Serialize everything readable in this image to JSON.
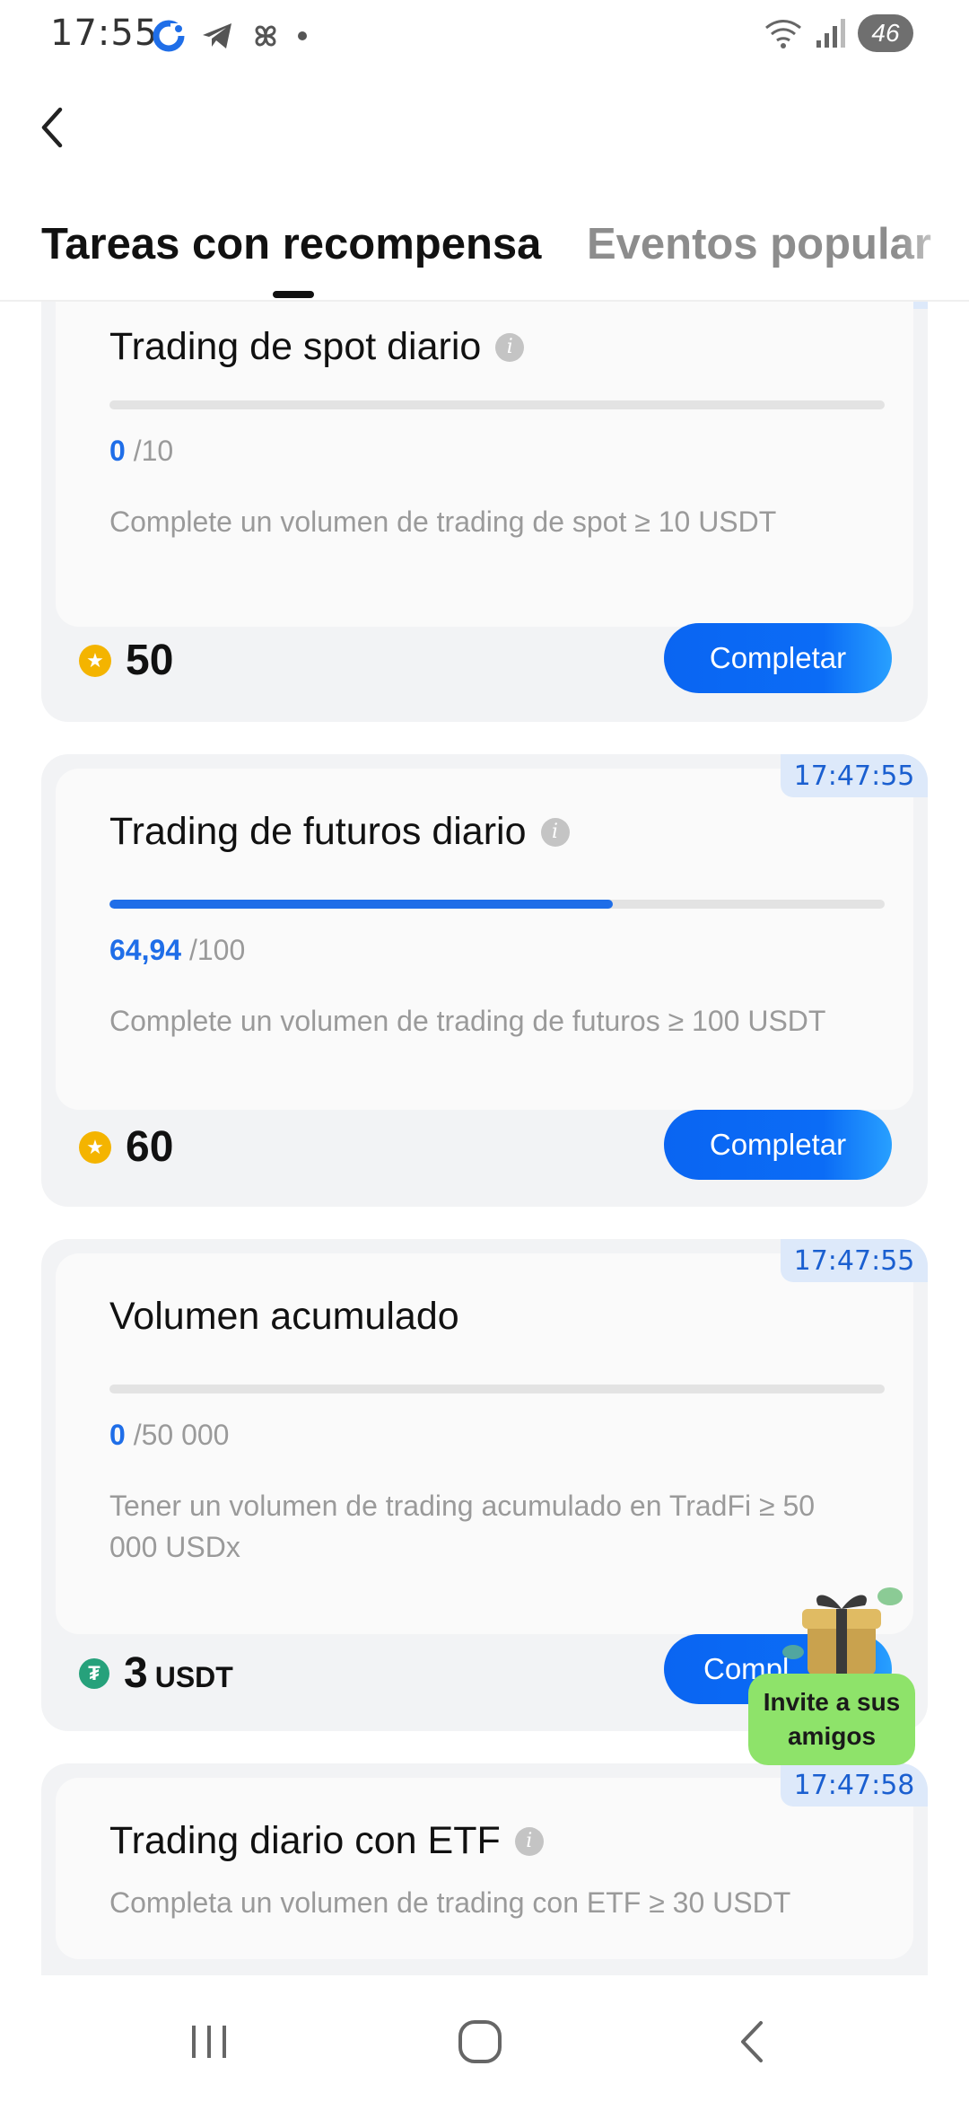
{
  "status_bar": {
    "time": "17:55",
    "battery": "46"
  },
  "tabs": [
    {
      "label": "Tareas con recompensa",
      "active": true
    },
    {
      "label": "Eventos popular",
      "active": false
    }
  ],
  "tasks": [
    {
      "title": "Trading de spot diario",
      "progress_current": "0",
      "progress_total": "/10",
      "progress_fraction": 0,
      "description": "Complete un volumen de trading de spot ≥ 10 USDT",
      "reward_value": "50",
      "reward_type": "coin",
      "button_label": "Completar"
    },
    {
      "timer": "17:47:55",
      "title": "Trading de futuros diario",
      "progress_current": "64,94",
      "progress_total": "/100",
      "progress_fraction": 0.6494,
      "description": "Complete un volumen de trading de futuros ≥ 100 USDT",
      "reward_value": "60",
      "reward_type": "coin",
      "button_label": "Completar"
    },
    {
      "timer": "17:47:55",
      "title": "Volumen acumulado",
      "progress_current": "0",
      "progress_total": "/50 000",
      "progress_fraction": 0,
      "description": "Tener un volumen de trading acumulado en TradFi ≥ 50 000 USDx",
      "reward_value": "3",
      "reward_unit": "USDT",
      "reward_type": "usdt",
      "button_label": "Compl"
    },
    {
      "timer": "17:47:58",
      "title": "Trading diario con ETF",
      "description": "Completa un volumen de trading con ETF ≥ 30 USDT"
    }
  ],
  "invite_widget": {
    "label": "Invite a sus amigos"
  },
  "colors": {
    "accent_blue": "#1f6ee8",
    "coin_gold": "#f4b400",
    "usdt_green": "#26a17b",
    "invite_green": "#8ee36a"
  },
  "icons": {
    "back": "chevron-left-icon",
    "info": "info-icon",
    "coin": "star-coin-icon",
    "usdt": "tether-icon",
    "gift": "gift-box-icon"
  }
}
